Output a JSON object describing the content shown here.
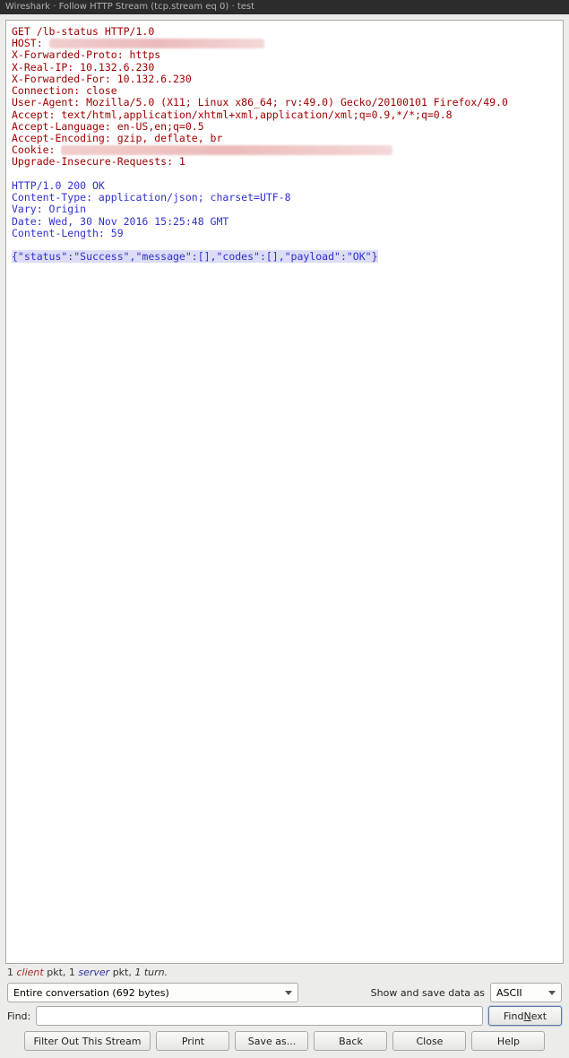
{
  "titlebar": "Wireshark · Follow HTTP Stream (tcp.stream eq 0) · test",
  "request": {
    "line1": "GET /lb-status HTTP/1.0",
    "host_label": "HOST: ",
    "x_forwarded_proto": "X-Forwarded-Proto: https",
    "x_real_ip": "X-Real-IP: 10.132.6.230",
    "x_forwarded_for": "X-Forwarded-For: 10.132.6.230",
    "connection": "Connection: close",
    "user_agent": "User-Agent: Mozilla/5.0 (X11; Linux x86_64; rv:49.0) Gecko/20100101 Firefox/49.0",
    "accept": "Accept: text/html,application/xhtml+xml,application/xml;q=0.9,*/*;q=0.8",
    "accept_language": "Accept-Language: en-US,en;q=0.5",
    "accept_encoding": "Accept-Encoding: gzip, deflate, br",
    "cookie_label": "Cookie: ",
    "upgrade": "Upgrade-Insecure-Requests: 1"
  },
  "response": {
    "status": "HTTP/1.0 200 OK",
    "content_type": "Content-Type: application/json; charset=UTF-8",
    "vary": "Vary: Origin",
    "date": "Date: Wed, 30 Nov 2016 15:25:48 GMT",
    "content_length": "Content-Length: 59",
    "body": "{\"status\":\"Success\",\"message\":[],\"codes\":[],\"payload\":\"OK\"}"
  },
  "summary": {
    "client_count": "1 ",
    "client_word": "client",
    "mid1": " pkt, ",
    "server_count": "1 ",
    "server_word": "server",
    "mid2": " pkt, ",
    "turn": "1 turn.",
    "turn_word": "turn"
  },
  "controls": {
    "conversation_select": "Entire conversation (692 bytes)",
    "show_save_label": "Show and save data as",
    "format_select": "ASCII",
    "find_label": "Find:",
    "find_next": "Find Next",
    "find_next_n": "N",
    "find_next_rest": "ext",
    "find_next_pre": "Find "
  },
  "buttons": {
    "filter": "Filter Out This Stream",
    "print": "Print",
    "saveas": "Save as...",
    "back": "Back",
    "close": "Close",
    "help": "Help"
  }
}
